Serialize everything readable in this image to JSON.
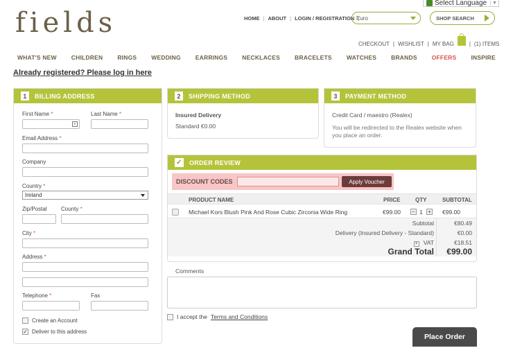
{
  "brand": {
    "logo_text": "fields"
  },
  "language": {
    "label": "Select Language"
  },
  "top_links": [
    "HOME",
    "ABOUT",
    "LOGIN / REGISTRATION"
  ],
  "currency": {
    "value": "Euro"
  },
  "search": {
    "label": "SHOP SEARCH"
  },
  "cart_links": {
    "checkout": "CHECKOUT",
    "wishlist": "WISHLIST",
    "my_bag": "MY BAG",
    "items": "(1) ITEMS"
  },
  "nav": [
    "WHAT'S NEW",
    "CHILDREN",
    "RINGS",
    "WEDDING",
    "EARRINGS",
    "NECKLACES",
    "BRACELETS",
    "WATCHES",
    "BRANDS",
    "OFFERS",
    "INSPIRE"
  ],
  "login_prompt": "Already registered? Please log in here",
  "billing": {
    "number": "1",
    "title": "BILLING ADDRESS",
    "first_name": "First Name",
    "last_name": "Last Name",
    "email": "Email Address",
    "company": "Company",
    "country_label": "Country",
    "country_value": "Ireland",
    "zip": "Zip/Postal",
    "county": "County",
    "city": "City",
    "address": "Address",
    "telephone": "Telephone",
    "fax": "Fax",
    "create_account": "Create an Account",
    "deliver_here": "Deliver to this address",
    "req": "*"
  },
  "shipping": {
    "number": "2",
    "title": "SHIPPING METHOD",
    "method": "Insured Delivery",
    "option": "Standard €0.00"
  },
  "payment": {
    "number": "3",
    "title": "PAYMENT METHOD",
    "method": "Credit Card / maestro (Realex)",
    "note": "You will be redirected to the Realex website when you place an order."
  },
  "review": {
    "title": "ORDER REVIEW",
    "discount_label": "DISCOUNT CODES",
    "apply_button": "Apply Voucher",
    "headers": {
      "product": "PRODUCT NAME",
      "price": "PRICE",
      "qty": "QTY",
      "subtotal": "SUBTOTAL"
    },
    "items": [
      {
        "name": "Michael Kors Blush Pink And Rose Cubic Zirconia Wide Ring",
        "price": "€99.00",
        "qty": "1",
        "subtotal": "€99.00"
      }
    ],
    "totals": {
      "subtotal_label": "Subtotal",
      "subtotal": "€80.49",
      "delivery_label": "Delivery (Insured Delivery - Standard)",
      "delivery": "€0.00",
      "vat_label": "VAT",
      "vat": "€18.51",
      "grand_label": "Grand Total",
      "grand": "€99.00"
    }
  },
  "comments_label": "Comments",
  "terms": {
    "prefix": "I accept the",
    "link": "Terms and Conditions"
  },
  "place_order": "Place Order"
}
